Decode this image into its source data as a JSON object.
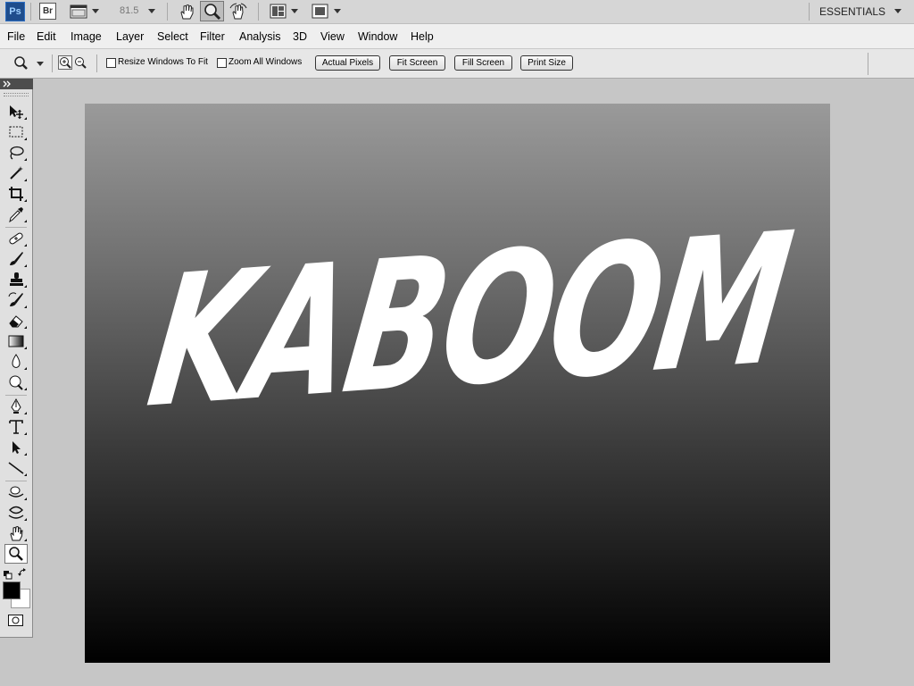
{
  "app": {
    "logo": "Ps",
    "bridge": "Br",
    "zoom_level": "81.5",
    "workspace": "ESSENTIALS"
  },
  "menu": [
    "File",
    "Edit",
    "Image",
    "Layer",
    "Select",
    "Filter",
    "Analysis",
    "3D",
    "View",
    "Window",
    "Help"
  ],
  "options": {
    "resize_windows_label": "Resize Windows To Fit",
    "zoom_all_label": "Zoom All Windows",
    "buttons": [
      "Actual Pixels",
      "Fit Screen",
      "Fill Screen",
      "Print Size"
    ]
  },
  "canvas": {
    "text": "KABOOM"
  },
  "tools": [
    "move-icon",
    "marquee-icon",
    "lasso-icon",
    "magic-wand-icon",
    "crop-icon",
    "eyedropper-icon",
    "healing-brush-icon",
    "brush-icon",
    "clone-stamp-icon",
    "history-brush-icon",
    "eraser-icon",
    "gradient-icon",
    "blur-icon",
    "dodge-icon",
    "pen-icon",
    "type-icon",
    "path-selection-icon",
    "line-icon",
    "3d-rotate-icon",
    "3d-orbit-icon",
    "hand-icon",
    "zoom-icon"
  ],
  "colors": {
    "foreground": "#000000",
    "background": "#ffffff"
  }
}
